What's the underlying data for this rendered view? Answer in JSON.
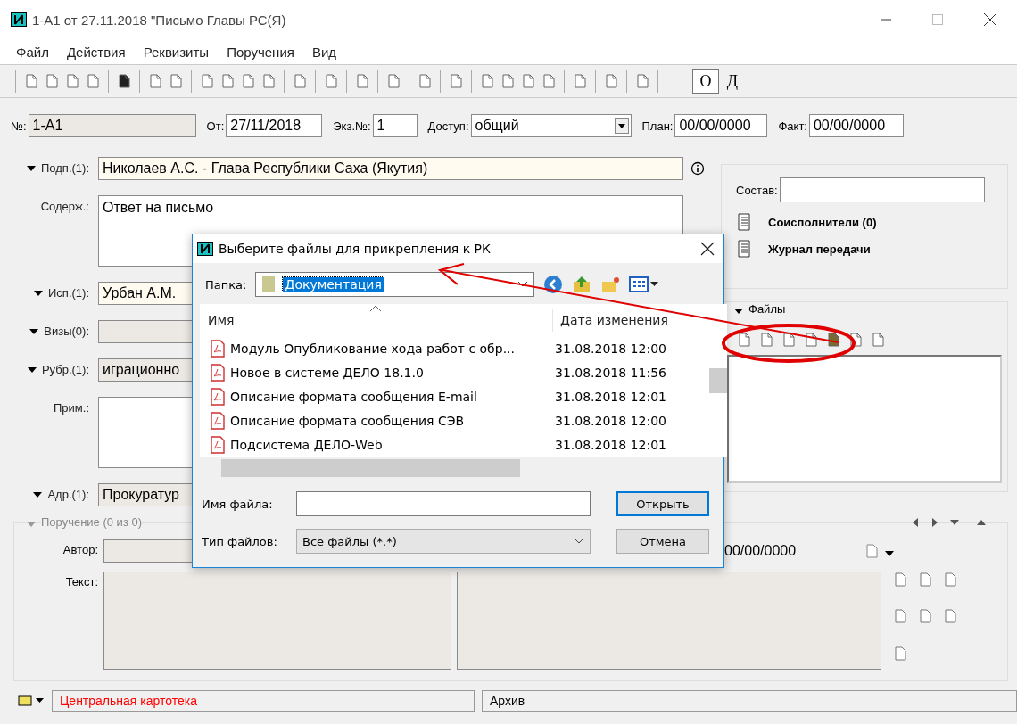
{
  "window": {
    "title": "1-А1 от 27.11.2018 \"Письмо Главы РС(Я)"
  },
  "menu": [
    "Файл",
    "Действия",
    "Реквизиты",
    "Поручения",
    "Вид"
  ],
  "toolbar": {
    "toggles": [
      {
        "label": "О",
        "selected": true
      },
      {
        "label": "Д",
        "selected": false
      }
    ]
  },
  "header_fields": [
    {
      "label": "№:",
      "value": "1-А1",
      "kind": "readonly"
    },
    {
      "label": "От:",
      "value": "27/11/2018",
      "kind": "input"
    },
    {
      "label": "Экз.№:",
      "value": "1",
      "kind": "input"
    },
    {
      "label": "Доступ:",
      "value": "общий",
      "kind": "select"
    },
    {
      "label": "План:",
      "value": "00/00/0000",
      "kind": "input"
    },
    {
      "label": "Факт:",
      "value": "00/00/0000",
      "kind": "input"
    }
  ],
  "form_fields": [
    {
      "label": "Подп.(1):",
      "value": "Николаев А.С. - Глава Республики Саха (Якутия)",
      "expander": true,
      "kind": "line"
    },
    {
      "label": "Содерж.:",
      "value": "Ответ на письмо",
      "expander": false,
      "kind": "area"
    },
    {
      "label": "Исп.(1):",
      "value": "Урбан А.М.",
      "expander": true,
      "kind": "line"
    },
    {
      "label": "Визы(0):",
      "expander": true,
      "kind": "readonly"
    },
    {
      "label": "Рубр.(1):",
      "value": "играционно",
      "expander": true,
      "kind": "readonly"
    },
    {
      "label": "Прим.:",
      "expander": false,
      "kind": "area"
    },
    {
      "label": "Адр.(1):",
      "value": "Прокуратур",
      "expander": true,
      "kind": "readonly"
    }
  ],
  "composition": {
    "label": "Состав:"
  },
  "links": [
    "Соисполнители (0)",
    "Журнал передачи"
  ],
  "files": {
    "title": "Файлы"
  },
  "assignment": {
    "title": "Поручение (0 из 0)",
    "author_label": "Автор:",
    "date": "00/00/0000",
    "text_label": "Текст:"
  },
  "status_bar": [
    {
      "text": "Центральная картотека",
      "color": "#ff0000"
    },
    {
      "text": "Архив",
      "color": "#000000"
    }
  ],
  "dialog": {
    "title": "Выберите файлы для прикрепления к РК",
    "folder_label": "Папка:",
    "folder": "Документация",
    "columns": [
      "Имя",
      "Дата изменения"
    ],
    "files": [
      {
        "name": "Модуль Опубликование хода работ с обр...",
        "date": "31.08.2018 12:00"
      },
      {
        "name": "Новое в системе ДЕЛО 18.1.0",
        "date": "31.08.2018 11:56"
      },
      {
        "name": "Описание формата сообщения E-mail",
        "date": "31.08.2018 12:01"
      },
      {
        "name": "Описание формата сообщения СЭВ",
        "date": "31.08.2018 12:00"
      },
      {
        "name": "Подсистема ДЕЛО-Web",
        "date": "31.08.2018 12:01"
      }
    ],
    "filename_label": "Имя файла:",
    "filetype_label": "Тип файлов:",
    "filetype": "Все файлы (*.*)",
    "buttons": [
      {
        "label": "Открыть",
        "default": true
      },
      {
        "label": "Отмена",
        "default": false
      }
    ]
  }
}
